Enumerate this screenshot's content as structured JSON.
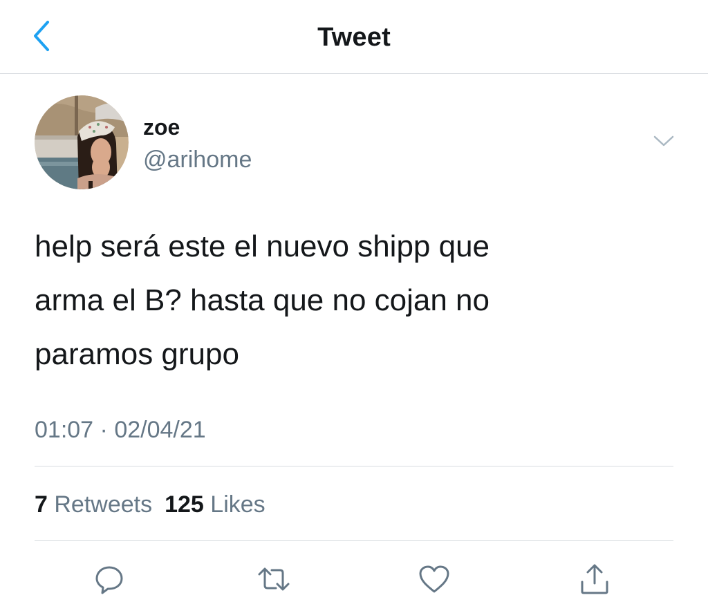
{
  "header": {
    "title": "Tweet",
    "back_icon": "chevron-left-icon",
    "accent_color": "#1da1f2"
  },
  "author": {
    "display_name": "zoe",
    "handle": "@arihome",
    "avatar": "profile-photo",
    "menu_icon": "chevron-down-icon"
  },
  "tweet": {
    "lines": [
      "help será este el nuevo shipp que",
      "arma el B? hasta que no cojan no",
      "paramos grupo"
    ],
    "time": "01:07",
    "separator": "·",
    "date": "02/04/21"
  },
  "stats": {
    "retweets_count": "7",
    "retweets_label": "Retweets",
    "likes_count": "125",
    "likes_label": "Likes"
  },
  "actions": [
    {
      "name": "reply",
      "icon": "reply-icon"
    },
    {
      "name": "retweet",
      "icon": "retweet-icon"
    },
    {
      "name": "like",
      "icon": "heart-icon"
    },
    {
      "name": "share",
      "icon": "share-icon"
    }
  ],
  "colors": {
    "text": "#14171a",
    "secondary": "#657786",
    "divider": "#d7dbdf",
    "icon": "#657786"
  }
}
